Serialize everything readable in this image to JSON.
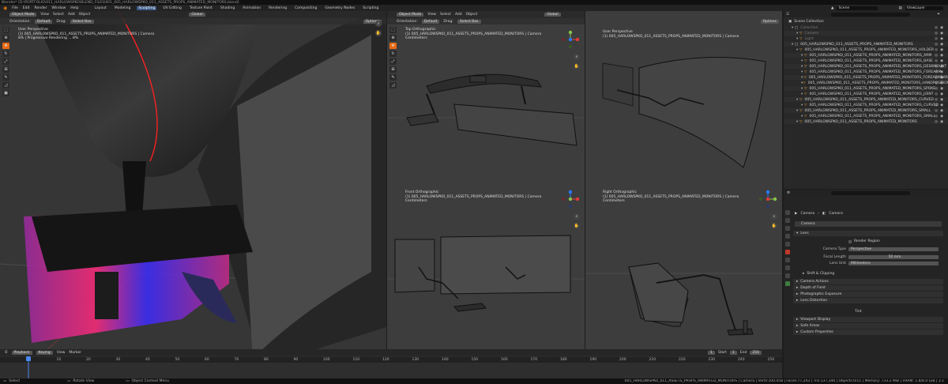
{
  "window": {
    "title": "Blender* [D:\\PORTFOLIO\\011_HARLOWSPKO\\BLEND_FILES\\001_005_HARLOWSPKO_011_ASSETS_PROPS_ANIMATED_MONITORS.blend]"
  },
  "menubar": {
    "items": [
      "File",
      "Edit",
      "Render",
      "Window",
      "Help"
    ],
    "workspaces": [
      "Layout",
      "Modeling",
      "Sculpting",
      "UV Editing",
      "Texture Paint",
      "Shading",
      "Animation",
      "Rendering",
      "Compositing",
      "Geometry Nodes",
      "Scripting"
    ],
    "active_workspace": "Layout"
  },
  "topright": {
    "scene_label": "Scene",
    "view_layer_label": "ViewLayer"
  },
  "viewport_left": {
    "mode": "Object Mode",
    "menus": [
      "View",
      "Select",
      "Add",
      "Object"
    ],
    "orientation_label": "Orientation:",
    "orientation": "Default",
    "drag_label": "Drag:",
    "drag": "Select Box",
    "transform": "Global",
    "options": "Options",
    "view_name": "User Perspective",
    "collection": "(1) 005_HARLOWSPKO_011_ASSETS_PROPS_ANIMATED_MONITORS | Camera",
    "render_status": "8% | Progressive Rendering ... 8%"
  },
  "viewport_top": {
    "mode": "Object Mode",
    "menus": [
      "View",
      "Select",
      "Add",
      "Object"
    ],
    "orientation_label": "Orientation:",
    "orientation": "Default",
    "drag_label": "Drag:",
    "drag": "Select Box",
    "transform": "Global",
    "options": "Options",
    "view_name": "Top Orthographic",
    "collection": "(1) 005_HARLOWSPKO_011_ASSETS_PROPS_ANIMATED_MONITORS | Camera",
    "units": "Centimeters"
  },
  "viewport_user2": {
    "view_name": "User Perspective",
    "collection": "(1) 005_HARLOWSPKO_011_ASSETS_PROPS_ANIMATED_MONITORS | Camera",
    "options": "Options"
  },
  "viewport_front": {
    "view_name": "Front Orthographic",
    "collection": "(1) 005_HARLOWSPKO_011_ASSETS_PROPS_ANIMATED_MONITORS | Camera",
    "units": "Centimeters"
  },
  "viewport_right": {
    "view_name": "Right Orthographic",
    "collection": "(1) 005_HARLOWSPKO_011_ASSETS_PROPS_ANIMATED_MONITORS | Camera",
    "units": "Centimeters"
  },
  "timeline": {
    "menus": [
      "Playback",
      "Keying",
      "View",
      "Marker"
    ],
    "current_frame": "1",
    "start_label": "Start",
    "start": "1",
    "end_label": "End",
    "end": "250",
    "ticks": [
      "0",
      "10",
      "20",
      "30",
      "40",
      "50",
      "60",
      "70",
      "80",
      "90",
      "100",
      "110",
      "120",
      "130",
      "140",
      "150",
      "160",
      "170",
      "180",
      "190",
      "200",
      "210",
      "220",
      "230",
      "240",
      "250"
    ]
  },
  "status": {
    "select": "Select",
    "rotate": "Rotate View",
    "context": "Object Context Menu",
    "stats": "005_HARLOWSPKO_011_ASSETS_PROPS_ANIMATED_MONITORS | Camera | Verts:100,058 | Faces:77,243 | Tris:137,340 | Objects:0/11 | Memory: 733.2 MiB | VRAM: 1.8/8.0 GiB | 3.1"
  },
  "outliner": {
    "header": "Scene Collection",
    "rows": [
      {
        "indent": 1,
        "text": "Collection",
        "dim": true
      },
      {
        "indent": 2,
        "text": "Camera",
        "dim": true
      },
      {
        "indent": 2,
        "text": "Light",
        "dim": true
      },
      {
        "indent": 1,
        "text": "005_HARLOWSPKO_011_ASSETS_PROPS_ANIMATED_MONITORS",
        "dim": false
      },
      {
        "indent": 2,
        "text": "005_HARLOWSPKO_011_ASSETS_PROPS_ANIMATED_MONITORS_HOLDER",
        "dim": false
      },
      {
        "indent": 3,
        "text": "005_HARLOWSPKO_011_ASSETS_PROPS_ANIMATED_MONITORS_ARM",
        "dim": false
      },
      {
        "indent": 3,
        "text": "005_HARLOWSPKO_011_ASSETS_PROPS_ANIMATED_MONITORS_BASE",
        "dim": false
      },
      {
        "indent": 3,
        "text": "005_HARLOWSPKO_011_ASSETS_PROPS_ANIMATED_MONITORS_DESKMOUNT",
        "dim": false
      },
      {
        "indent": 3,
        "text": "005_HARLOWSPKO_011_ASSETS_PROPS_ANIMATED_MONITORS_FOREARM",
        "dim": false
      },
      {
        "indent": 3,
        "text": "005_HARLOWSPKO_011_ASSETS_PROPS_ANIMATED_MONITORS_FOREARMBAR",
        "dim": false
      },
      {
        "indent": 3,
        "text": "005_HARLOWSPKO_011_ASSETS_PROPS_ANIMATED_MONITORS_HANDPOSITION",
        "dim": false
      },
      {
        "indent": 3,
        "text": "005_HARLOWSPKO_011_ASSETS_PROPS_ANIMATED_MONITORS_SPOKE",
        "dim": false
      },
      {
        "indent": 3,
        "text": "005_HARLOWSPKO_011_ASSETS_PROPS_ANIMATED_MONITORS_JOINT",
        "dim": false
      },
      {
        "indent": 2,
        "text": "005_HARLOWSPKO_011_ASSETS_PROPS_ANIMATED_MONITORS_CURVED",
        "dim": false
      },
      {
        "indent": 3,
        "text": "005_HARLOWSPKO_011_ASSETS_PROPS_ANIMATED_MONITORS_CURVED",
        "dim": false
      },
      {
        "indent": 2,
        "text": "005_HARLOWSPKO_011_ASSETS_PROPS_ANIMATED_MONITORS_SMALL",
        "dim": false
      },
      {
        "indent": 3,
        "text": "005_HARLOWSPKO_011_ASSETS_PROPS_ANIMATED_MONITORS_SMALL",
        "dim": false
      },
      {
        "indent": 2,
        "text": "005_HARLOWSPKO_011_ASSETS_PROPS_ANIMATED_MONITORS",
        "dim": false
      }
    ]
  },
  "properties": {
    "breadcrumb_object": "Camera",
    "breadcrumb_data": "Camera",
    "datablock": "Camera",
    "lens_section": "Lens",
    "render_region": "Render Region",
    "fields": [
      {
        "label": "Camera Type",
        "value": "Perspective"
      },
      {
        "label": "Focal Length",
        "value": "50 mm"
      },
      {
        "label": "Lens Unit",
        "value": "Millimeters"
      }
    ],
    "shift_label": "Shift & Clipping",
    "sections": [
      "Camera Actions",
      "Depth of Field",
      "Photographic Exposure",
      "Lens Distortion",
      "Viewport Display",
      "Safe Areas",
      "Custom Properties"
    ],
    "tint": "Tint"
  }
}
